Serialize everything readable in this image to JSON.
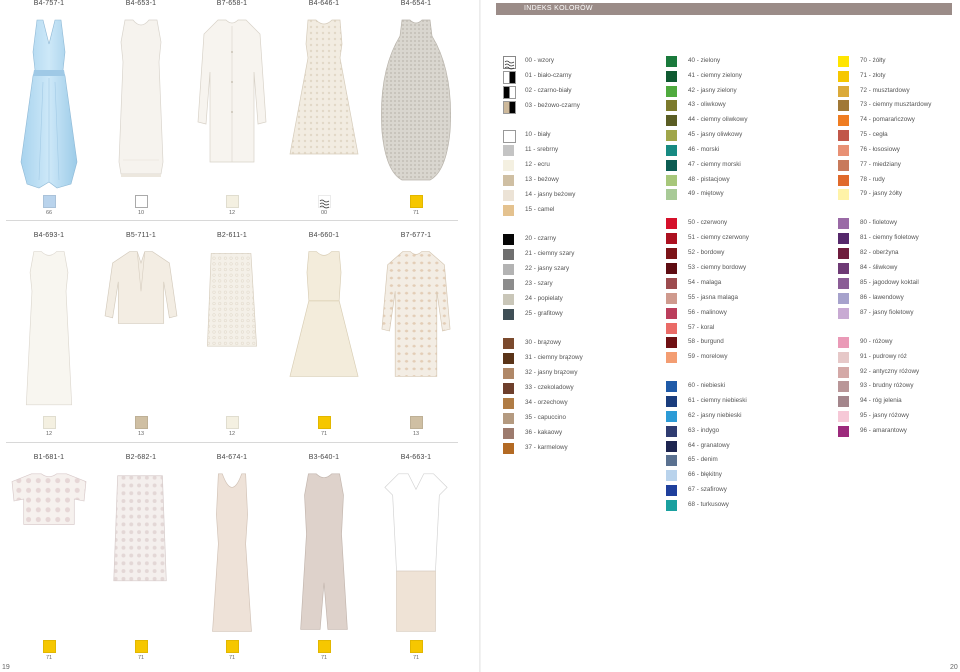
{
  "page_numbers": {
    "left": "19",
    "right": "20"
  },
  "header": {
    "title": "INDEKS KOLORÓW"
  },
  "catalog_rows": [
    {
      "items": [
        {
          "code": "B4-757-1",
          "swatch_number": "66",
          "swatch_color": "#b9d3ec"
        },
        {
          "code": "B4-653-1",
          "swatch_number": "10",
          "swatch_color": "#ffffff"
        },
        {
          "code": "B7-658-1",
          "swatch_number": "12",
          "swatch_color": "#f4f0e1"
        },
        {
          "code": "B4-646-1",
          "swatch_number": "00",
          "swatch_color": "pattern"
        },
        {
          "code": "B4-654-1",
          "swatch_number": "71",
          "swatch_color": "#f6c700"
        }
      ]
    },
    {
      "items": [
        {
          "code": "B4-693-1",
          "swatch_number": "12",
          "swatch_color": "#f4f0e1"
        },
        {
          "code": "B5-711-1",
          "swatch_number": "13",
          "swatch_color": "#cfbfa3"
        },
        {
          "code": "B2-611-1",
          "swatch_number": "12",
          "swatch_color": "#f4f0e1"
        },
        {
          "code": "B4-660-1",
          "swatch_number": "71",
          "swatch_color": "#f6c700"
        },
        {
          "code": "B7-677-1",
          "swatch_number": "13",
          "swatch_color": "#cfbfa3"
        }
      ]
    },
    {
      "items": [
        {
          "code": "B1-681-1",
          "swatch_number": "71",
          "swatch_color": "#f6c700"
        },
        {
          "code": "B2-682-1",
          "swatch_number": "71",
          "swatch_color": "#f6c700"
        },
        {
          "code": "B4-674-1",
          "swatch_number": "71",
          "swatch_color": "#f6c700"
        },
        {
          "code": "B3-640-1",
          "swatch_number": "71",
          "swatch_color": "#f6c700"
        },
        {
          "code": "B4-663-1",
          "swatch_number": "71",
          "swatch_color": "#f6c700"
        }
      ]
    }
  ],
  "color_index": {
    "col1": [
      {
        "label": "00 - wzory",
        "color": "pattern"
      },
      {
        "label": "01 - biało-czarny",
        "color": "split:#ffffff:#000000"
      },
      {
        "label": "02 - czarno-biały",
        "color": "split:#000000:#ffffff"
      },
      {
        "label": "03 - beżowo-czarny",
        "color": "split:#cdb99b:#000000"
      },
      {
        "label": "10 - biały",
        "color": "#ffffff"
      },
      {
        "label": "11 - srebrny",
        "color": "#c4c4c4"
      },
      {
        "label": "12 - ecru",
        "color": "#f4f0e1"
      },
      {
        "label": "13 - beżowy",
        "color": "#cfbfa3"
      },
      {
        "label": "14 - jasny beżowy",
        "color": "#ece3d6"
      },
      {
        "label": "15 - camel",
        "color": "#e4c28f"
      },
      {
        "label": "20 - czarny",
        "color": "#050505"
      },
      {
        "label": "21 - ciemny szary",
        "color": "#6f6f6f"
      },
      {
        "label": "22 - jasny szary",
        "color": "#b3b3b3"
      },
      {
        "label": "23 - szary",
        "color": "#8c8c8c"
      },
      {
        "label": "24 - popielaty",
        "color": "#c9c6b8"
      },
      {
        "label": "25 - grafitowy",
        "color": "#3f4f56"
      },
      {
        "label": "30 - brązowy",
        "color": "#7b4a2d"
      },
      {
        "label": "31 - ciemny brązowy",
        "color": "#5a3418"
      },
      {
        "label": "32 - jasny brązowy",
        "color": "#b08868"
      },
      {
        "label": "33 - czekoladowy",
        "color": "#6e3f2c"
      },
      {
        "label": "34 - orzechowy",
        "color": "#b07c45"
      },
      {
        "label": "35 - capuccino",
        "color": "#b49a80"
      },
      {
        "label": "36 - kakaowy",
        "color": "#9d7b6e"
      },
      {
        "label": "37 - karmelowy",
        "color": "#b36a24"
      }
    ],
    "col2": [
      {
        "label": "40 - zielony",
        "color": "#1a7a3c"
      },
      {
        "label": "41 - ciemny zielony",
        "color": "#0f5a32"
      },
      {
        "label": "42 - jasny zielony",
        "color": "#4faa3e"
      },
      {
        "label": "43 - oliwkowy",
        "color": "#7c7a2c"
      },
      {
        "label": "44 - ciemny oliwkowy",
        "color": "#5a5d24"
      },
      {
        "label": "45 - jasny oliwkowy",
        "color": "#a0a64a"
      },
      {
        "label": "46 - morski",
        "color": "#178a82"
      },
      {
        "label": "47 - ciemny morski",
        "color": "#0c5c52"
      },
      {
        "label": "48 - pistacjowy",
        "color": "#a7c77a"
      },
      {
        "label": "49 - miętowy",
        "color": "#a8ca97"
      },
      {
        "label": "50 - czerwony",
        "color": "#d5102a"
      },
      {
        "label": "51 - ciemny czerwony",
        "color": "#ac1020"
      },
      {
        "label": "52 - bordowy",
        "color": "#7c1418"
      },
      {
        "label": "53 - ciemny bordowy",
        "color": "#5e0c12"
      },
      {
        "label": "54 - malaga",
        "color": "#9c4b4e"
      },
      {
        "label": "55 - jasna malaga",
        "color": "#cf9a8e"
      },
      {
        "label": "56 - malinowy",
        "color": "#bb3e5c"
      },
      {
        "label": "57 - koral",
        "color": "#ea6b67"
      },
      {
        "label": "58 - burgund",
        "color": "#6f1013"
      },
      {
        "label": "59 - morelowy",
        "color": "#f39d72"
      },
      {
        "label": "60 - niebieski",
        "color": "#1f5aa8"
      },
      {
        "label": "61 - ciemny niebieski",
        "color": "#1a3d7d"
      },
      {
        "label": "62 - jasny niebieski",
        "color": "#2c9bd6"
      },
      {
        "label": "63 - indygo",
        "color": "#2f3c71"
      },
      {
        "label": "64 - granatowy",
        "color": "#1d2550"
      },
      {
        "label": "65 - denim",
        "color": "#5a7190"
      },
      {
        "label": "66 - błękitny",
        "color": "#b9d3ec"
      },
      {
        "label": "67 - szafirowy",
        "color": "#1f3f9c"
      },
      {
        "label": "68 - turkusowy",
        "color": "#1aa09f"
      }
    ],
    "col3": [
      {
        "label": "70 - żółty",
        "color": "#ffe500"
      },
      {
        "label": "71 - złoty",
        "color": "#f6c700"
      },
      {
        "label": "72 - musztardowy",
        "color": "#dbaa3a"
      },
      {
        "label": "73 - ciemny musztardowy",
        "color": "#a07836"
      },
      {
        "label": "74 - pomarańczowy",
        "color": "#ef7d22"
      },
      {
        "label": "75 - cegła",
        "color": "#c1574a"
      },
      {
        "label": "76 - łososiowy",
        "color": "#e89175"
      },
      {
        "label": "77 - miedziany",
        "color": "#c87a5b"
      },
      {
        "label": "78 - rudy",
        "color": "#e06a2b"
      },
      {
        "label": "79 - jasny żółty",
        "color": "#fff3a8"
      },
      {
        "label": "80 - fioletowy",
        "color": "#9a6aa6"
      },
      {
        "label": "81 - ciemny fioletowy",
        "color": "#55286b"
      },
      {
        "label": "82 - oberżyna",
        "color": "#6e1c3d"
      },
      {
        "label": "84 - śliwkowy",
        "color": "#6e3a75"
      },
      {
        "label": "85 - jagodowy koktail",
        "color": "#8b5d96"
      },
      {
        "label": "86 - lawendowy",
        "color": "#a6a2cc"
      },
      {
        "label": "87 - jasny fioletowy",
        "color": "#c8aad3"
      },
      {
        "label": "90 - różowy",
        "color": "#ea9ab7"
      },
      {
        "label": "91 - pudrowy róż",
        "color": "#e6c8c8"
      },
      {
        "label": "92 - antyczny różowy",
        "color": "#d4a9a7"
      },
      {
        "label": "93 - brudny różowy",
        "color": "#b99698"
      },
      {
        "label": "94 - róg jelenia",
        "color": "#a4868c"
      },
      {
        "label": "95 - jasny różowy",
        "color": "#f6c8d7"
      },
      {
        "label": "96 - amarantowy",
        "color": "#9c2a7c"
      }
    ]
  }
}
